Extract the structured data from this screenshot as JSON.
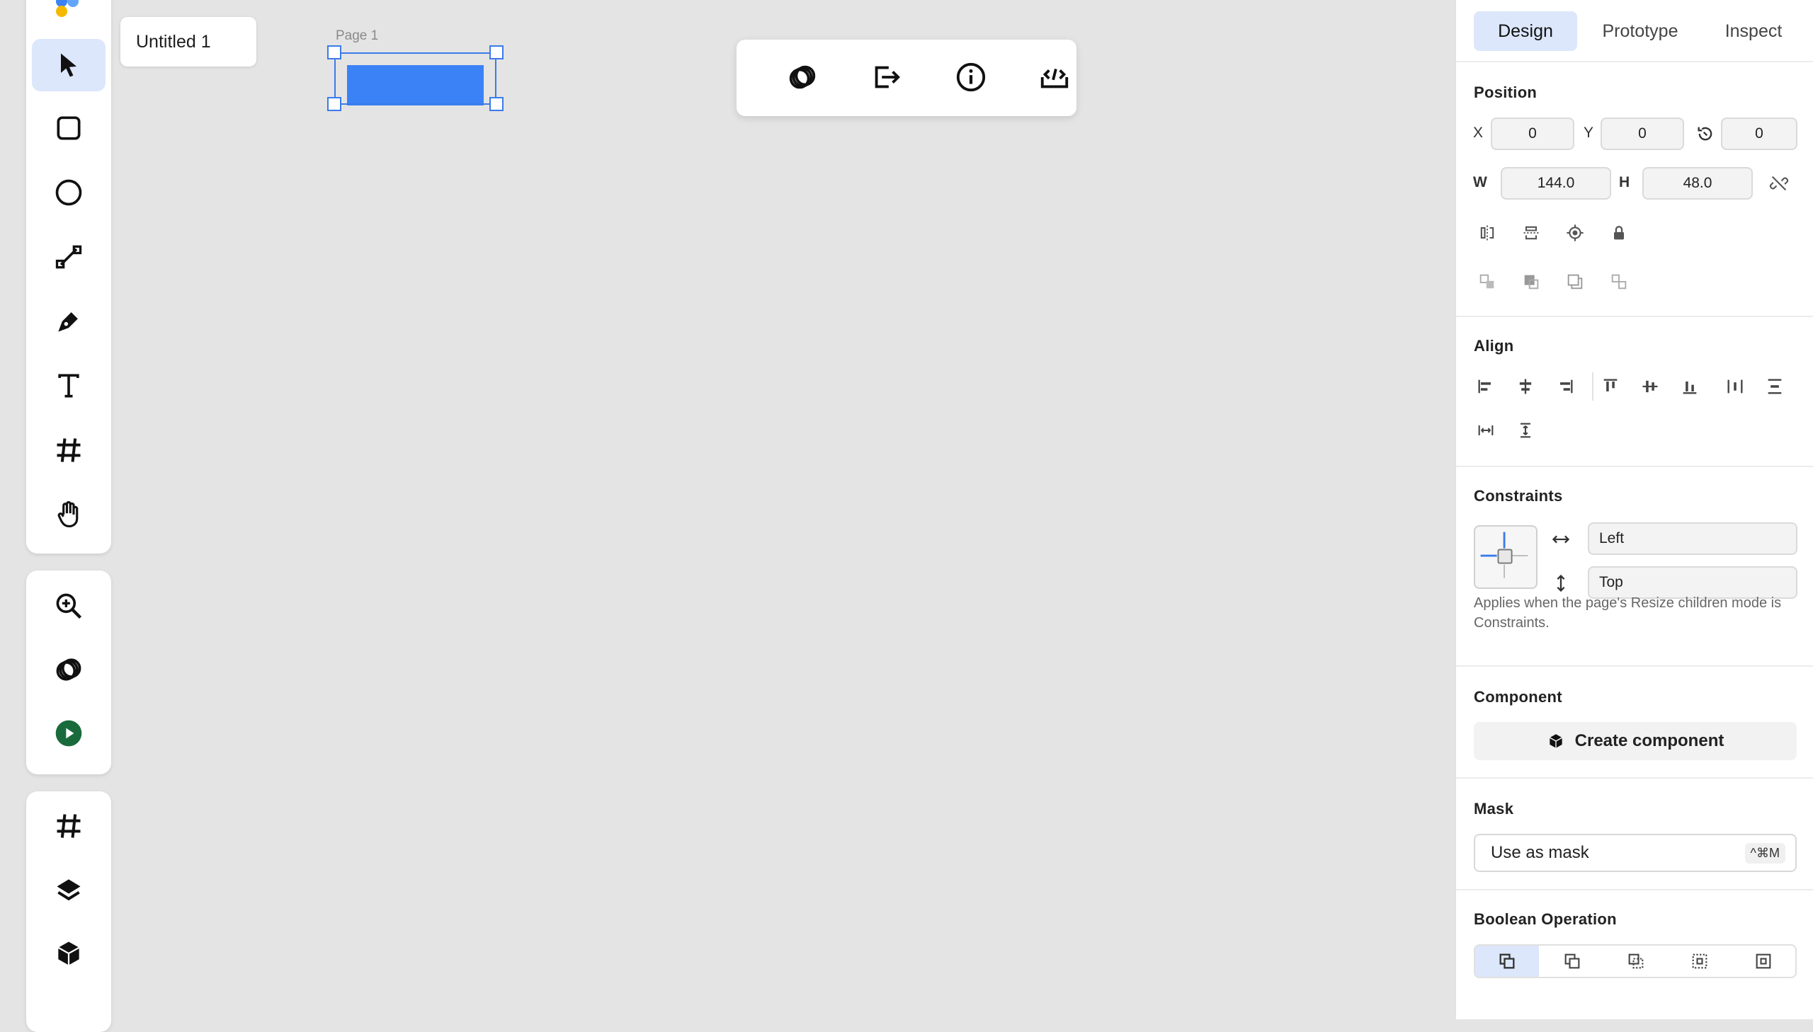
{
  "document": {
    "tab_title": "Untitled 1",
    "page_label": "Page 1"
  },
  "panel": {
    "tabs": [
      "Design",
      "Prototype",
      "Inspect"
    ],
    "position": {
      "title": "Position",
      "x_label": "X",
      "x": "0",
      "y_label": "Y",
      "y": "0",
      "rotation": "0",
      "w_label": "W",
      "w": "144.0",
      "h_label": "H",
      "h": "48.0"
    },
    "align": {
      "title": "Align"
    },
    "constraints": {
      "title": "Constraints",
      "horizontal": "Left",
      "vertical": "Top",
      "note": "Applies when the page's Resize children mode is Constraints."
    },
    "component": {
      "title": "Component",
      "button": "Create component"
    },
    "mask": {
      "title": "Mask",
      "button": "Use as mask",
      "shortcut": "^⌘M"
    },
    "boolean": {
      "title": "Boolean Operation"
    }
  },
  "colors": {
    "accent": "#3b82f6",
    "selection": "#3b7be8",
    "active_bg": "#dce7fb",
    "play": "#1a6b3c"
  },
  "icons": {
    "toolbar": [
      "select-arrow-icon",
      "rectangle-icon",
      "ellipse-icon",
      "line-icon",
      "pen-icon",
      "text-icon",
      "frame-icon",
      "hand-icon"
    ],
    "toolbar2": [
      "zoom-icon",
      "rings-icon",
      "play-icon"
    ],
    "toolbar3": [
      "grid-icon",
      "layers-icon",
      "component-box-icon"
    ],
    "floating": [
      "rings-icon",
      "export-icon",
      "info-icon",
      "code-icon"
    ]
  }
}
